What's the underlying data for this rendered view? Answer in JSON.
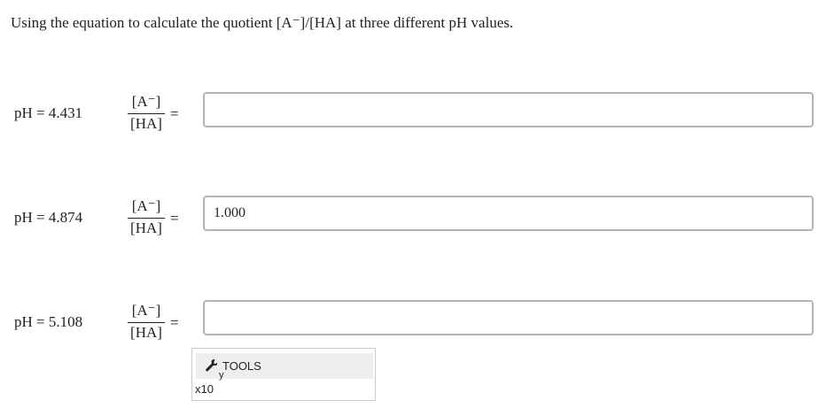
{
  "question": {
    "instruction": "Using the equation to calculate the quotient [A⁻]/[HA] at three different pH values."
  },
  "rows": [
    {
      "ph_label": "pH = 4.431",
      "fraction_numerator": "[A⁻]",
      "fraction_denominator": "[HA]",
      "equals": "=",
      "input_value": ""
    },
    {
      "ph_label": "pH = 4.874",
      "fraction_numerator": "[A⁻]",
      "fraction_denominator": "[HA]",
      "equals": "=",
      "input_value": "1.000"
    },
    {
      "ph_label": "pH = 5.108",
      "fraction_numerator": "[A⁻]",
      "fraction_denominator": "[HA]",
      "equals": "=",
      "input_value": ""
    }
  ],
  "tools": {
    "tools_label": "TOOLS",
    "subscript_label": "y",
    "x10_label": "x10",
    "icon": "wrench-icon"
  }
}
